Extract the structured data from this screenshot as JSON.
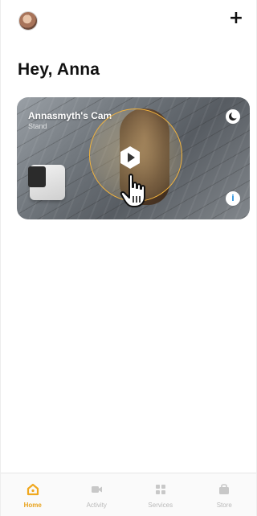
{
  "header": {
    "avatar_icon": "user-avatar",
    "add_icon": "plus-icon",
    "add_label": "+"
  },
  "greeting": "Hey, Anna",
  "camera": {
    "name": "Annasmyth's Cam",
    "status": "Stand",
    "mode_icon": "moon-icon",
    "info_icon": "info-icon",
    "info_label": "i",
    "play_icon": "play-icon",
    "accent_color": "#f2b33d"
  },
  "tabs": [
    {
      "label": "Home",
      "icon": "home-icon",
      "active": true
    },
    {
      "label": "Activity",
      "icon": "activity-icon",
      "active": false
    },
    {
      "label": "Services",
      "icon": "services-grid-icon",
      "active": false
    },
    {
      "label": "Store",
      "icon": "store-icon",
      "active": false
    }
  ],
  "colors": {
    "brand": "#f0a81f",
    "tab_inactive": "#b9b9b9",
    "text": "#111111"
  }
}
